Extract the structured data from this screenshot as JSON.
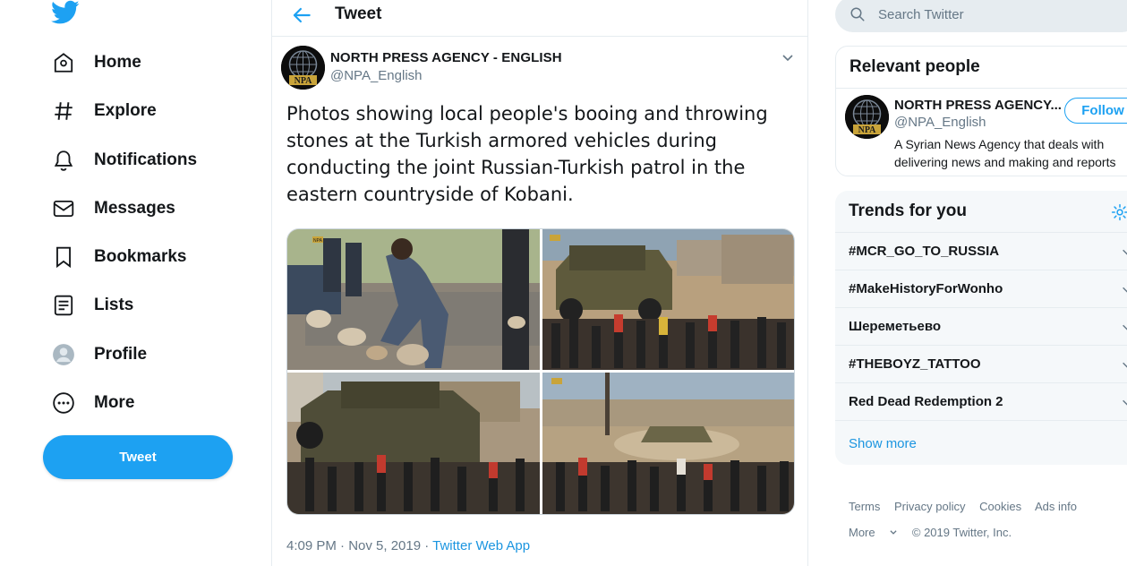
{
  "nav": {
    "items": [
      {
        "label": "Home",
        "icon": "home-icon"
      },
      {
        "label": "Explore",
        "icon": "hashtag-icon"
      },
      {
        "label": "Notifications",
        "icon": "bell-icon"
      },
      {
        "label": "Messages",
        "icon": "mail-icon"
      },
      {
        "label": "Bookmarks",
        "icon": "bookmark-icon"
      },
      {
        "label": "Lists",
        "icon": "list-icon"
      },
      {
        "label": "Profile",
        "icon": "profile-icon"
      },
      {
        "label": "More",
        "icon": "more-icon"
      }
    ],
    "tweet_button": "Tweet",
    "brand_color": "#1da1f2"
  },
  "header": {
    "title": "Tweet"
  },
  "tweet": {
    "author_name": "NORTH PRESS AGENCY - ENGLISH",
    "author_handle": "@NPA_English",
    "avatar_text": "NPA",
    "text": "Photos showing local people's booing and throwing stones at the Turkish armored vehicles during conducting the joint Russian-Turkish patrol in the eastern countryside of Kobani.",
    "timestamp": "4:09 PM · Nov 5, 2019 · ",
    "source_app": "Twitter Web App",
    "photo_watermark": "NPA"
  },
  "search": {
    "placeholder": "Search Twitter"
  },
  "relevant_people": {
    "title": "Relevant people",
    "name": "NORTH PRESS AGENCY...",
    "handle": "@NPA_English",
    "bio_line1": "A Syrian News Agency that deals with",
    "bio_line2": "delivering news and making and reports",
    "follow_label": "Follow"
  },
  "trends": {
    "title": "Trends for you",
    "items": [
      "#MCR_GO_TO_RUSSIA",
      "#MakeHistoryForWonho",
      "Шереметьево",
      "#THEBOYZ_TATTOO",
      "Red Dead Redemption 2"
    ],
    "show_more": "Show more"
  },
  "footer": {
    "links_row1": [
      "Terms",
      "Privacy policy",
      "Cookies",
      "Ads info"
    ],
    "more": "More",
    "copyright": "© 2019 Twitter, Inc."
  }
}
